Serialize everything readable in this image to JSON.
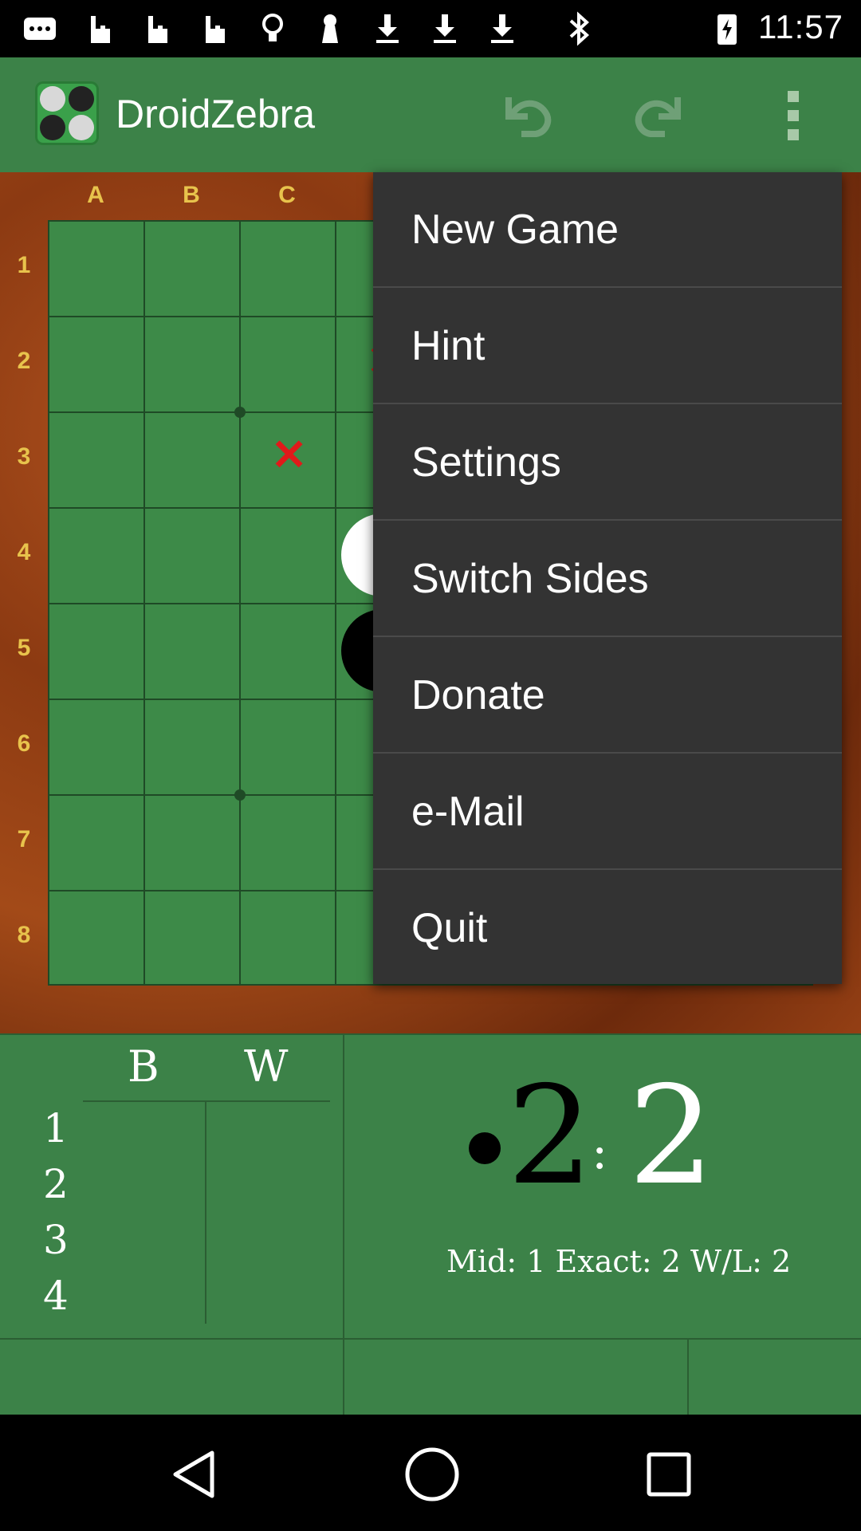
{
  "status_bar": {
    "time": "11:57",
    "icons": [
      "messages-icon",
      "hand-icon",
      "hand-icon",
      "hand-icon",
      "bulb-icon",
      "keyhole-icon",
      "download-icon",
      "download-icon",
      "download-icon",
      "bluetooth-icon",
      "battery-charging-icon"
    ]
  },
  "app_bar": {
    "title": "DroidZebra",
    "undo_icon": "undo-icon",
    "redo_icon": "redo-icon",
    "overflow_icon": "more-vert-icon"
  },
  "board": {
    "columns": [
      "A",
      "B",
      "C"
    ],
    "rows": [
      "1",
      "2",
      "3",
      "4",
      "5",
      "6",
      "7",
      "8"
    ],
    "colors": {
      "felt": "#3d8a48",
      "lines": "#1f4a26",
      "labels": "#e8c34c",
      "hint_mark": "#e01a1a"
    }
  },
  "menu": {
    "items": [
      "New Game",
      "Hint",
      "Settings",
      "Switch Sides",
      "Donate",
      "e-Mail",
      "Quit"
    ]
  },
  "move_list": {
    "col_black": "B",
    "col_white": "W",
    "move_numbers": [
      "1",
      "2",
      "3",
      "4"
    ]
  },
  "score": {
    "black": "2",
    "separator": ":",
    "white": "2",
    "eval": "Mid: 1 Exact: 2 W/L: 2"
  },
  "nav_bar": {
    "back_icon": "back-triangle-icon",
    "home_icon": "home-circle-icon",
    "recents_icon": "recents-square-icon"
  }
}
